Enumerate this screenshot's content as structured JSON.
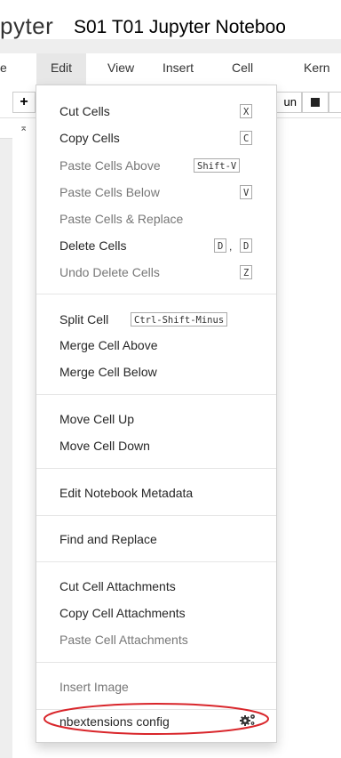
{
  "header": {
    "logo_text": "pyter",
    "notebook_title": "S01 T01 Jupyter Noteboo"
  },
  "menubar": {
    "file": "e",
    "edit": "Edit",
    "view": "View",
    "insert": "Insert",
    "cell": "Cell",
    "kernel": "Kern"
  },
  "toolbar": {
    "add_icon": "+",
    "run_label": "un",
    "collapse_icon": "⌅"
  },
  "edit_menu": {
    "items": [
      {
        "label": "Cut Cells",
        "shortcut": "X",
        "enabled": true
      },
      {
        "label": "Copy Cells",
        "shortcut": "C",
        "enabled": true
      },
      {
        "label": "Paste Cells Above",
        "shortcut": "Shift-V",
        "enabled": false
      },
      {
        "label": "Paste Cells Below",
        "shortcut": "V",
        "enabled": false
      },
      {
        "label": "Paste Cells & Replace",
        "shortcut": "",
        "enabled": false
      },
      {
        "label": "Delete Cells",
        "shortcut": "D",
        "shortcut2": "D",
        "shortcut_sep": ",",
        "enabled": true
      },
      {
        "label": "Undo Delete Cells",
        "shortcut": "Z",
        "enabled": false
      },
      {
        "label": "Split Cell",
        "shortcut": "Ctrl-Shift-Minus",
        "enabled": true
      },
      {
        "label": "Merge Cell Above",
        "enabled": true
      },
      {
        "label": "Merge Cell Below",
        "enabled": true
      },
      {
        "label": "Move Cell Up",
        "enabled": true
      },
      {
        "label": "Move Cell Down",
        "enabled": true
      },
      {
        "label": "Edit Notebook Metadata",
        "enabled": true
      },
      {
        "label": "Find and Replace",
        "enabled": true
      },
      {
        "label": "Cut Cell Attachments",
        "enabled": true
      },
      {
        "label": "Copy Cell Attachments",
        "enabled": true
      },
      {
        "label": "Paste Cell Attachments",
        "enabled": false
      },
      {
        "label": "Insert Image",
        "enabled": false
      },
      {
        "label": "nbextensions config",
        "icon": "gears-icon",
        "enabled": true
      }
    ]
  },
  "colors": {
    "highlight_ellipse": "#d9262b",
    "menu_active_bg": "#e7e7e7",
    "disabled_text": "#777777"
  }
}
